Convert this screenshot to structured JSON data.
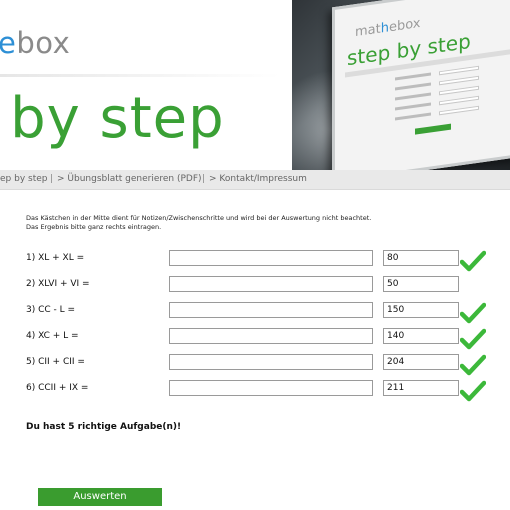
{
  "header": {
    "logo_visible": "ebox",
    "title_visible": "o by step"
  },
  "photo_screen": {
    "logo_prefix": "mat",
    "logo_accent": "h",
    "logo_suffix": "ebox",
    "title": "step by step"
  },
  "nav": {
    "items": [
      "ep by step",
      "|",
      "> Übungsblatt generieren (PDF)",
      "|",
      "> Kontakt/Impressum"
    ]
  },
  "instructions": {
    "line1": "Das Kästchen in der Mitte dient für Notizen/Zwischenschritte und wird bei der Auswertung nicht beachtet.",
    "line2": "Das Ergebnis bitte ganz rechts eintragen."
  },
  "exercises": [
    {
      "label": "1) XL + XL =",
      "answer": "80",
      "correct": true
    },
    {
      "label": "2) XLVI + VI =",
      "answer": "50",
      "correct": false
    },
    {
      "label": "3) CC - L =",
      "answer": "150",
      "correct": true
    },
    {
      "label": "4) XC + L =",
      "answer": "140",
      "correct": true
    },
    {
      "label": "5) CII + CII =",
      "answer": "204",
      "correct": true
    },
    {
      "label": "6) CCII + IX =",
      "answer": "211",
      "correct": true
    }
  ],
  "result_text": "Du hast 5 richtige Aufgabe(n)!",
  "submit_label": "Auswerten",
  "colors": {
    "brand_green": "#3aa035",
    "brand_blue": "#2d8fd5",
    "check_green": "#3cb83a"
  }
}
